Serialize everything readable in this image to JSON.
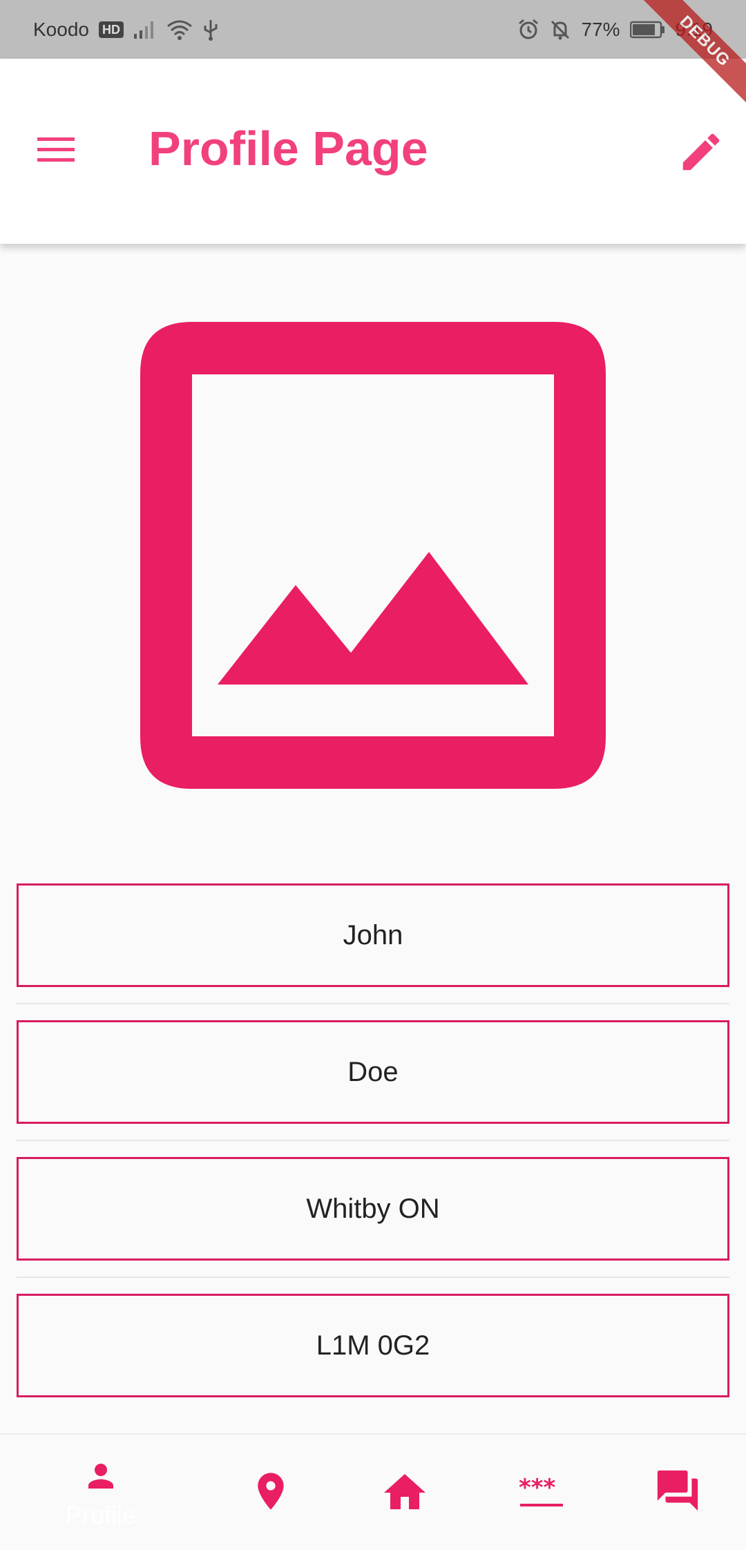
{
  "status_bar": {
    "carrier": "Koodo",
    "network_badge": "HD",
    "battery": "77%",
    "time": "9:19",
    "icons": [
      "signal-icon",
      "wifi-icon",
      "usb-icon",
      "alarm-icon",
      "notifications-off-icon",
      "battery-icon"
    ]
  },
  "debug_banner": "DEBUG",
  "app_bar": {
    "title": "Profile Page",
    "left_icon": "menu-icon",
    "right_icon": "edit-icon"
  },
  "profile": {
    "image_icon": "image-icon",
    "fields": [
      {
        "value": "John"
      },
      {
        "value": "Doe"
      },
      {
        "value": "Whitby ON"
      },
      {
        "value": "L1M 0G2"
      }
    ]
  },
  "bottom_nav": {
    "items": [
      {
        "icon": "person-icon",
        "label": "Profile",
        "selected": true
      },
      {
        "icon": "location-icon",
        "label": ""
      },
      {
        "icon": "home-icon",
        "label": ""
      },
      {
        "icon": "password-icon",
        "label": ""
      },
      {
        "icon": "chat-icon",
        "label": ""
      }
    ]
  },
  "colors": {
    "accent": "#e91e63",
    "title": "#f2407e",
    "field_border": "#d81b60",
    "status_bar": "#bdbdbd"
  }
}
